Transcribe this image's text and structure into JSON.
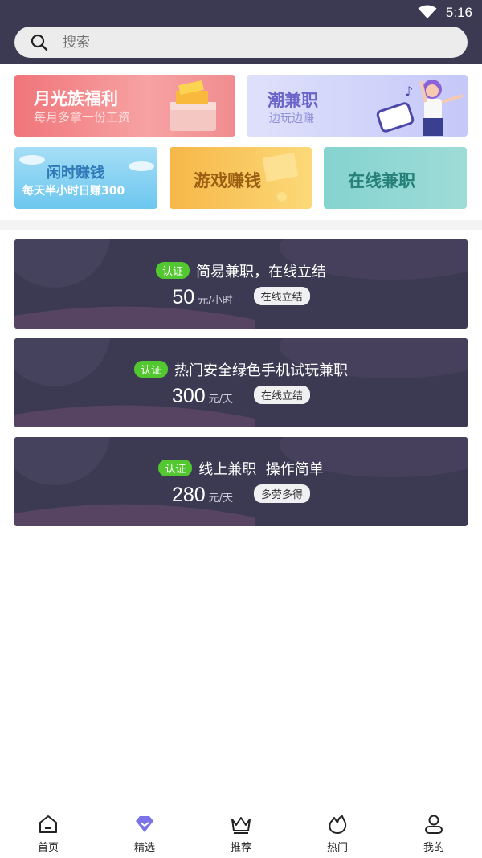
{
  "status_bar": {
    "time": "5:16",
    "wifi_icon": "wifi-icon"
  },
  "search": {
    "placeholder": "搜索",
    "icon": "search-icon"
  },
  "banners": [
    {
      "title": "月光族福利",
      "subtitle": "每月多拿一份工资"
    },
    {
      "title": "潮兼职",
      "subtitle": "边玩边赚"
    },
    {
      "title": "闲时赚钱",
      "subtitle": "每天半小时日赚300"
    },
    {
      "title": "游戏赚钱"
    },
    {
      "title": "在线兼职"
    }
  ],
  "jobs": [
    {
      "badge": "认证",
      "title": "简易兼职，在线立结",
      "price": "50",
      "unit": "元/小时",
      "tag": "在线立结"
    },
    {
      "badge": "认证",
      "title": "热门安全绿色手机试玩兼职",
      "price": "300",
      "unit": "元/天",
      "tag": "在线立结"
    },
    {
      "badge": "认证",
      "title": "线上兼职  操作简单",
      "price": "280",
      "unit": "元/天",
      "tag": "多劳多得"
    }
  ],
  "tabbar": [
    {
      "label": "首页",
      "icon": "home-icon"
    },
    {
      "label": "精选",
      "icon": "diamond-icon",
      "active": true
    },
    {
      "label": "推荐",
      "icon": "crown-icon"
    },
    {
      "label": "热门",
      "icon": "fire-icon"
    },
    {
      "label": "我的",
      "icon": "user-icon"
    }
  ],
  "colors": {
    "header_bg": "#3c3a52",
    "badge_green": "#52c72f",
    "active_tab": "#7b73e8"
  }
}
